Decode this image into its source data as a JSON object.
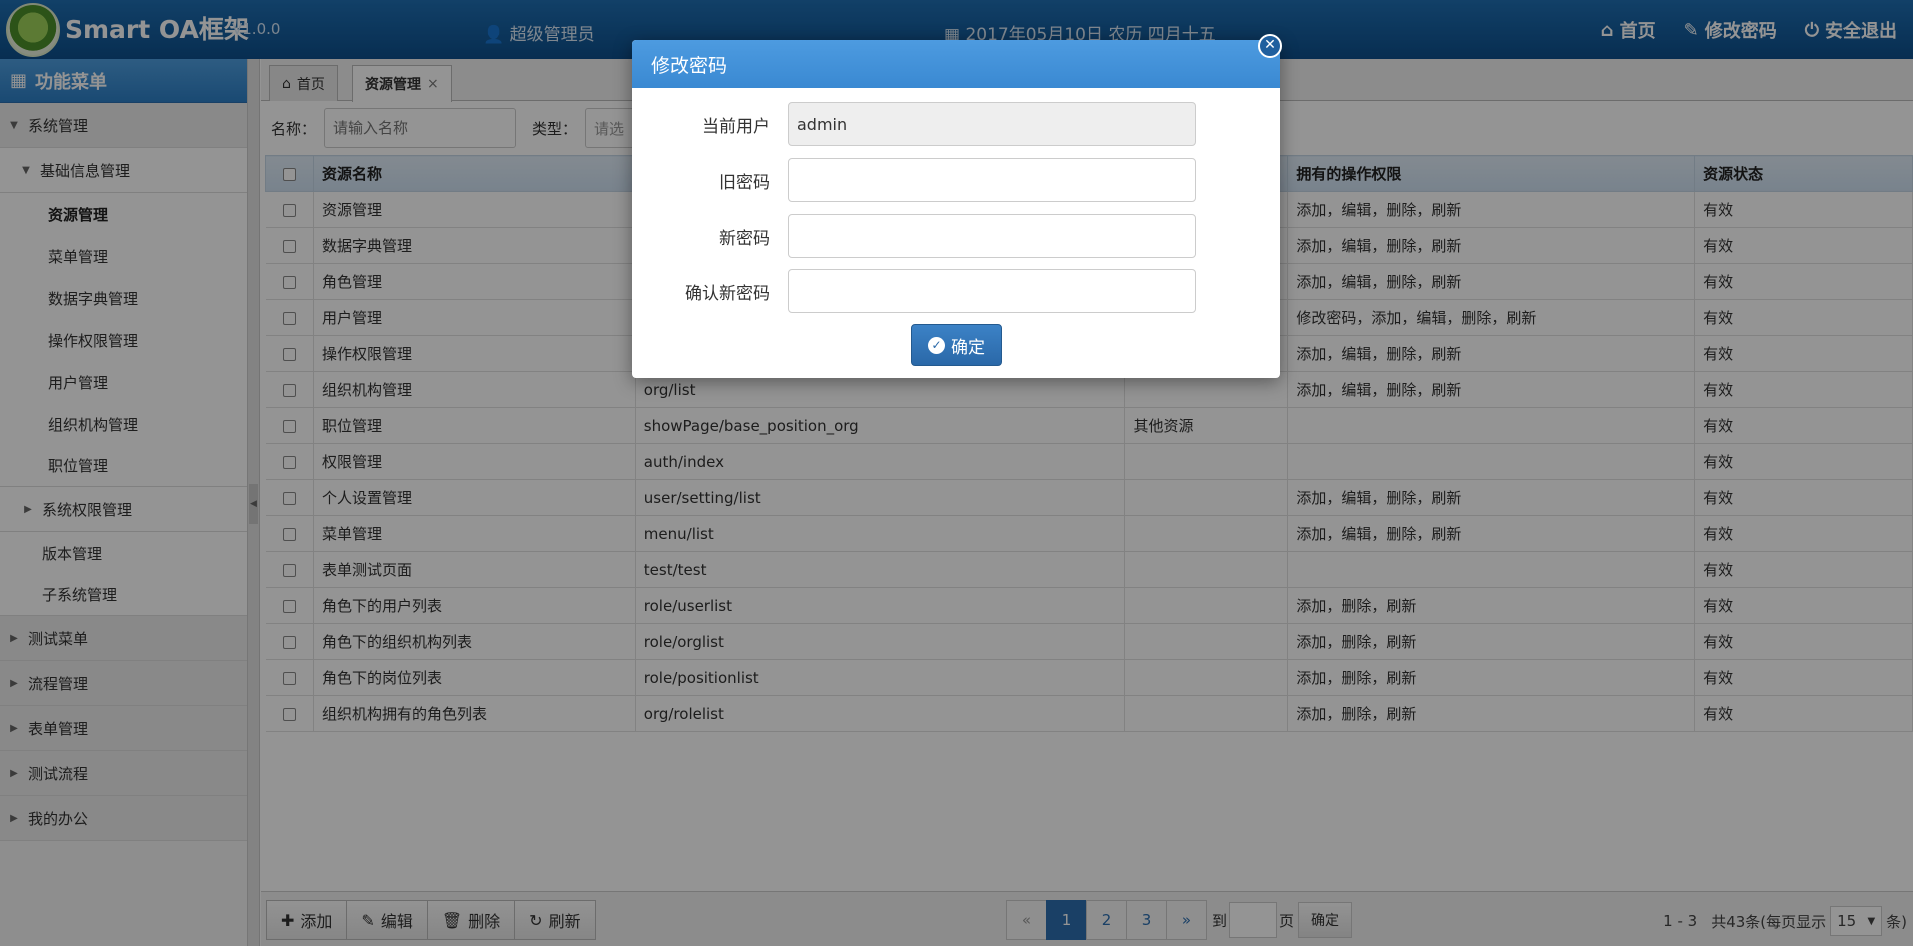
{
  "header": {
    "brand": "Smart OA框架",
    "version": "V1.0.0",
    "user": "超级管理员",
    "date": "2017年05月10日 农历 四月十五",
    "links": {
      "home": "首页",
      "change_password": "修改密码",
      "logout": "安全退出"
    }
  },
  "sidebar": {
    "title": "功能菜单",
    "system": "系统管理",
    "basic": "基础信息管理",
    "basic_items": [
      "资源管理",
      "菜单管理",
      "数据字典管理",
      "操作权限管理",
      "用户管理",
      "组织机构管理",
      "职位管理"
    ],
    "sys_perm": "系统权限管理",
    "version_mgmt": "版本管理",
    "subsystem": "子系统管理",
    "top_menus": [
      "测试菜单",
      "流程管理",
      "表单管理",
      "测试流程",
      "我的办公"
    ]
  },
  "tabs": {
    "home": "首页",
    "resource": "资源管理",
    "close": "×"
  },
  "filter": {
    "name_label": "名称：",
    "name_placeholder": "请输入名称",
    "type_label": "类型：",
    "type_value": "请选"
  },
  "grid": {
    "headers": {
      "name": "资源名称",
      "url": "",
      "type": "",
      "perms": "拥有的操作权限",
      "status": "资源状态"
    },
    "rows": [
      {
        "name": "资源管理",
        "url": "",
        "type": "",
        "perms": "添加，编辑，删除，刷新",
        "status": "有效"
      },
      {
        "name": "数据字典管理",
        "url": "",
        "type": "",
        "perms": "添加，编辑，删除，刷新",
        "status": "有效"
      },
      {
        "name": "角色管理",
        "url": "",
        "type": "",
        "perms": "添加，编辑，删除，刷新",
        "status": "有效"
      },
      {
        "name": "用户管理",
        "url": "",
        "type": "",
        "perms": "修改密码，添加，编辑，删除，刷新",
        "status": "有效"
      },
      {
        "name": "操作权限管理",
        "url": "",
        "type": "",
        "perms": "添加，编辑，删除，刷新",
        "status": "有效"
      },
      {
        "name": "组织机构管理",
        "url": "org/list",
        "type": "",
        "perms": "添加，编辑，删除，刷新",
        "status": "有效"
      },
      {
        "name": "职位管理",
        "url": "showPage/base_position_org",
        "type": "其他资源",
        "perms": "",
        "status": "有效"
      },
      {
        "name": "权限管理",
        "url": "auth/index",
        "type": "",
        "perms": "",
        "status": "有效"
      },
      {
        "name": "个人设置管理",
        "url": "user/setting/list",
        "type": "",
        "perms": "添加，编辑，删除，刷新",
        "status": "有效"
      },
      {
        "name": "菜单管理",
        "url": "menu/list",
        "type": "",
        "perms": "添加，编辑，删除，刷新",
        "status": "有效"
      },
      {
        "name": "表单测试页面",
        "url": "test/test",
        "type": "",
        "perms": "",
        "status": "有效"
      },
      {
        "name": "角色下的用户列表",
        "url": "role/userlist",
        "type": "",
        "perms": "添加，删除，刷新",
        "status": "有效"
      },
      {
        "name": "角色下的组织机构列表",
        "url": "role/orglist",
        "type": "",
        "perms": "添加，删除，刷新",
        "status": "有效"
      },
      {
        "name": "角色下的岗位列表",
        "url": "role/positionlist",
        "type": "",
        "perms": "添加，删除，刷新",
        "status": "有效"
      },
      {
        "name": "组织机构拥有的角色列表",
        "url": "org/rolelist",
        "type": "",
        "perms": "添加，删除，刷新",
        "status": "有效"
      }
    ]
  },
  "toolbar": {
    "add": "添加",
    "edit": "编辑",
    "delete": "删除",
    "refresh": "刷新"
  },
  "pager": {
    "prev": "«",
    "pages": [
      "1",
      "2",
      "3"
    ],
    "current": "1",
    "next": "»",
    "goto_prefix": "到",
    "goto_suffix": "页",
    "goto_button": "确定",
    "range": "1 - 3",
    "total_prefix": "共43条(每页显示",
    "page_size": "15",
    "total_suffix": "条)"
  },
  "modal": {
    "title": "修改密码",
    "current_user_label": "当前用户",
    "current_user_value": "admin",
    "old_password_label": "旧密码",
    "new_password_label": "新密码",
    "confirm_password_label": "确认新密码",
    "ok_label": "确定"
  },
  "colors": {
    "header": "#0d4f8c",
    "accent": "#3a89d2",
    "button": "#2a68a8"
  },
  "icons": [
    "logo-tree",
    "user-icon",
    "calendar-icon",
    "home-icon",
    "edit-icon",
    "power-icon",
    "grid-icon",
    "plus-icon",
    "pencil-icon",
    "trash-icon",
    "refresh-icon",
    "check-circle-icon",
    "close-icon"
  ]
}
